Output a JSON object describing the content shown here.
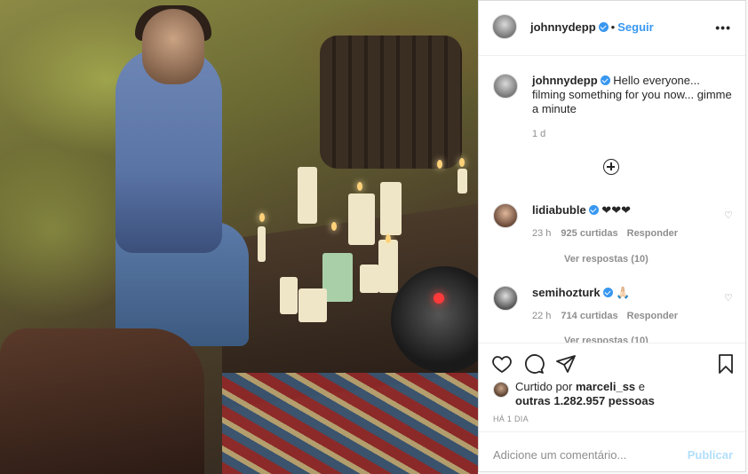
{
  "post": {
    "author": "johnnydepp",
    "separator": "•",
    "follow_label": "Seguir",
    "more_icon": "•••"
  },
  "caption": {
    "author": "johnnydepp",
    "text": "Hello everyone... filming something for you now... gimme a minute",
    "time": "1 d"
  },
  "comments": [
    {
      "author": "lidiabuble",
      "verified": true,
      "text": "❤❤❤",
      "time": "23 h",
      "likes": "925 curtidas",
      "reply_label": "Responder",
      "view_replies": "Ver respostas (10)"
    },
    {
      "author": "semihozturk",
      "verified": true,
      "text": "🙏🏻",
      "time": "22 h",
      "likes": "714 curtidas",
      "reply_label": "Responder",
      "view_replies": "Ver respostas (10)"
    }
  ],
  "likes": {
    "prefix": "Curtido por",
    "user": "marceli_ss",
    "joiner": "e",
    "others": "outras 1.282.957 pessoas"
  },
  "date_label": "HÁ 1 DIA",
  "add_comment": {
    "placeholder": "Adicione um comentário...",
    "publish_label": "Publicar"
  },
  "colors": {
    "link": "#3897f0",
    "verified": "#3897f0",
    "publish_disabled": "#b2dffc"
  }
}
